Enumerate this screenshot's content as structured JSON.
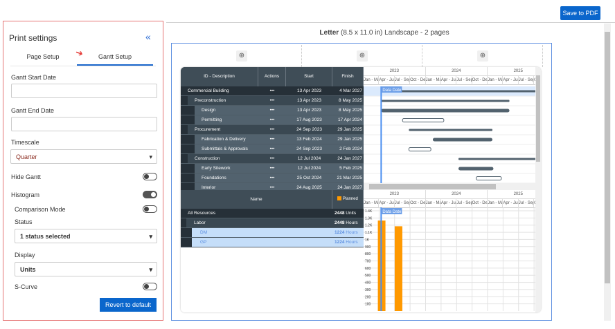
{
  "header": {
    "save_label": "Save to PDF"
  },
  "panel": {
    "title": "Print settings",
    "tabs": [
      "Page Setup",
      "Gantt Setup"
    ],
    "gantt_start_label": "Gantt Start Date",
    "gantt_start_value": "",
    "gantt_end_label": "Gantt End Date",
    "gantt_end_value": "",
    "timescale_label": "Timescale",
    "timescale_value": "Quarter",
    "hide_gantt_label": "Hide Gantt",
    "hide_gantt": false,
    "histogram_label": "Histogram",
    "histogram": true,
    "comparison_label": "Comparison Mode",
    "comparison": false,
    "status_label": "Status",
    "status_value": "1 status selected",
    "display_label": "Display",
    "display_value": "Units",
    "scurve_label": "S-Curve",
    "scurve": false,
    "revert_label": "Revert to default"
  },
  "preview": {
    "paper": "Letter",
    "paper_detail": "(8.5 x 11.0 in) Landscape - 2 pages"
  },
  "table": {
    "headers": [
      "ID - Description",
      "Actions",
      "Start",
      "Finish"
    ],
    "actions_glyph": "•••",
    "rows": [
      {
        "name": "Commercial Building",
        "level": 0,
        "start": "13 Apr 2023",
        "finish": "4 Mar 2027"
      },
      {
        "name": "Preconstruction",
        "level": 1,
        "start": "13 Apr 2023",
        "finish": "8 May 2025"
      },
      {
        "name": "Design",
        "level": 2,
        "start": "13 Apr 2023",
        "finish": "8 May 2025"
      },
      {
        "name": "Permitting",
        "level": 2,
        "start": "17 Aug 2023",
        "finish": "17 Apr 2024"
      },
      {
        "name": "Procurement",
        "level": 1,
        "start": "24 Sep 2023",
        "finish": "29 Jan 2025"
      },
      {
        "name": "Fabrication & Delivery",
        "level": 2,
        "start": "13 Feb 2024",
        "finish": "29 Jan 2025"
      },
      {
        "name": "Submittals & Approvals",
        "level": 2,
        "start": "24 Sep 2023",
        "finish": "2 Feb 2024"
      },
      {
        "name": "Construction",
        "level": 1,
        "start": "12 Jul 2024",
        "finish": "24 Jan 2027"
      },
      {
        "name": "Early Sitework",
        "level": 2,
        "start": "12 Jul 2024",
        "finish": "5 Feb 2025"
      },
      {
        "name": "Foundations",
        "level": 2,
        "start": "25 Oct 2024",
        "finish": "21 Mar 2025"
      },
      {
        "name": "Interior",
        "level": 2,
        "start": "24 Aug 2025",
        "finish": "24 Jan 2027"
      }
    ]
  },
  "timeline": {
    "years": [
      "2023",
      "2024",
      "2025"
    ],
    "quarters": [
      "Jan - Mar",
      "Apr - Jun",
      "Jul - Sep",
      "Oct - Dec",
      "Jan - Mar",
      "Apr - Jun",
      "Jul - Sep",
      "Oct - Dec",
      "Jan - Mar",
      "Apr - Jun",
      "Jul - Sep",
      "Oct - Dec"
    ],
    "data_date_label": "Data Date"
  },
  "resources": {
    "name_header": "Name",
    "legend": "Planned",
    "legend_color": "#ff9900",
    "rows": [
      {
        "name": "All Resources",
        "value": "2448",
        "unit": "Units",
        "level": 0
      },
      {
        "name": "Labor",
        "value": "2448",
        "unit": "Hours",
        "level": 1
      },
      {
        "name": "DM",
        "value": "1224",
        "unit": "Hours",
        "level": 2
      },
      {
        "name": "GP",
        "value": "1224",
        "unit": "Hours",
        "level": 2
      }
    ]
  },
  "chart_data": {
    "type": "bar",
    "title": "Resource histogram",
    "xlabel": "",
    "ylabel": "",
    "categories": [
      "Apr - Jun 2023",
      "Jul - Sep 2023"
    ],
    "series": [
      {
        "name": "Planned",
        "values": [
          1264,
          1184
        ]
      }
    ],
    "ylim": [
      0,
      1400
    ],
    "yticks": [
      "100",
      "200",
      "300",
      "400",
      "500",
      "600",
      "700",
      "800",
      "900",
      "1K",
      "1.1K",
      "1.2K",
      "1.3K",
      "1.4K"
    ],
    "grid": true
  }
}
